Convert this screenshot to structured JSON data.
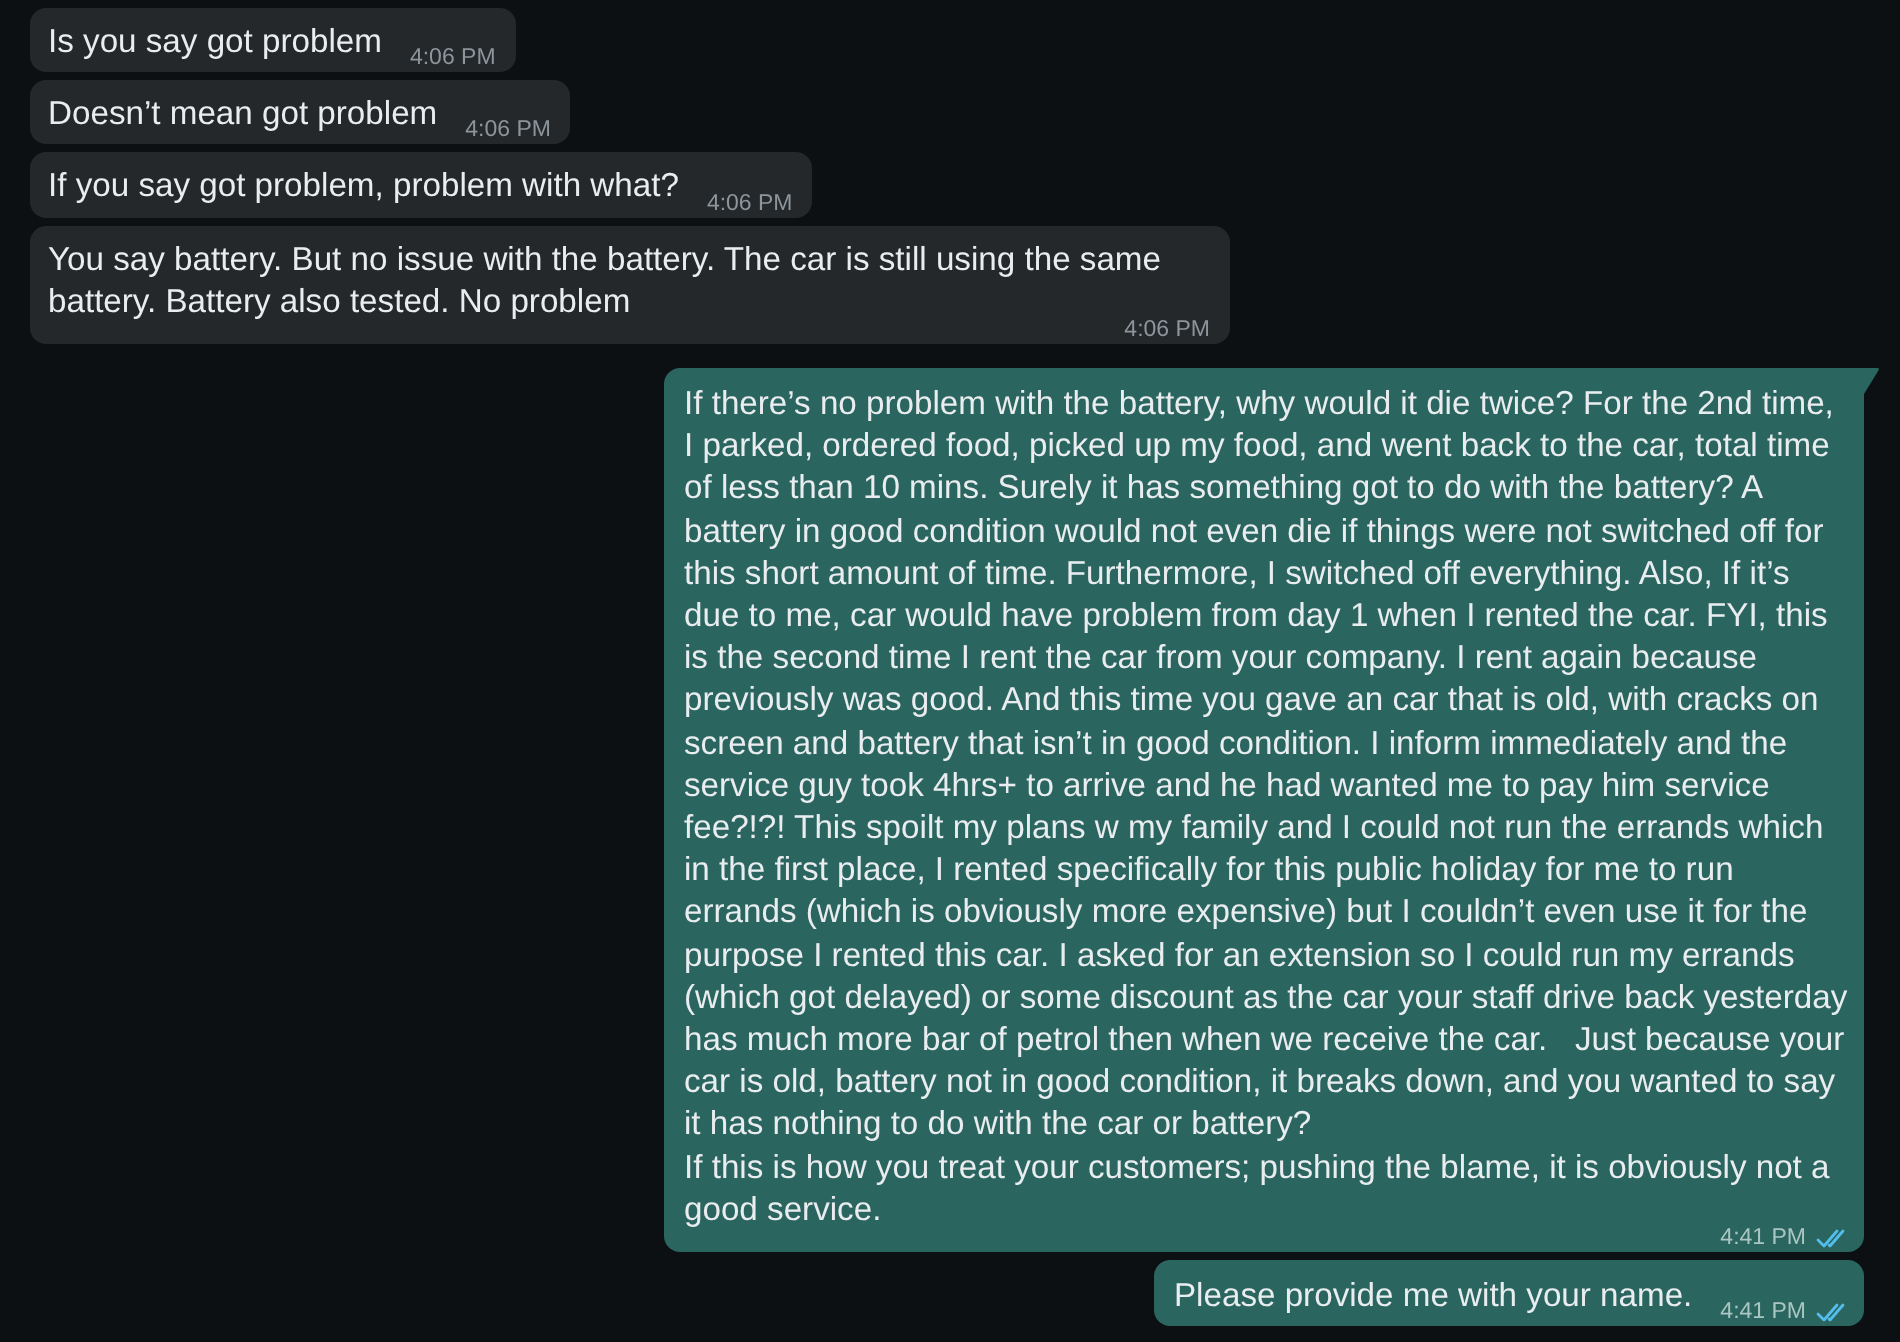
{
  "messages": [
    {
      "kind": "incoming",
      "text": "Is you say got problem",
      "time": "4:06 PM",
      "tail": false
    },
    {
      "kind": "incoming",
      "text": "Doesn’t mean got problem",
      "time": "4:06 PM",
      "tail": false
    },
    {
      "kind": "incoming",
      "text": "If you say got problem, problem with what?",
      "time": "4:06 PM",
      "tail": false
    },
    {
      "kind": "incoming",
      "text": "You say battery. But no issue with the battery. The car is still using the same battery. Battery also tested. No problem",
      "time": "4:06 PM",
      "tail": false
    },
    {
      "kind": "outgoing",
      "text": "If there’s no problem with the battery, why would it die twice? For the 2nd time, I parked, ordered food, picked up my food, and went back to the car, total time of less than 10 mins. Surely it has something got to do with the battery? A battery in good condition would not even die if things were not switched off for this short amount of time. Furthermore, I switched off everything. Also, If it’s due to me, car would have problem from day 1 when I rented the car. FYI, this is the second time I rent the car from your company. I rent again because previously was good. And this time you gave an car that is old, with cracks on screen and battery that isn’t in good condition. I inform immediately and the service guy took 4hrs+ to arrive and he had wanted me to pay him service fee?!?! This spoilt my plans w my family and I could not run the errands which in the first place, I rented specifically for this public holiday for me to run errands (which is obviously more expensive) but I couldn’t even use it for the purpose I rented this car. I asked for an extension so I could run my errands (which got delayed) or some discount as the car your staff drive back yesterday has much more bar of petrol then when we receive the car.   Just because your car is old, battery not in good condition, it breaks down, and you wanted to say it has nothing to do with the car or battery?\nIf this is how you treat your customers; pushing the blame, it is obviously not a good service.",
      "time": "4:41 PM",
      "read": true,
      "tail": true
    },
    {
      "kind": "outgoing",
      "text": "Please provide me with your name.",
      "time": "4:41 PM",
      "read": true,
      "tail": false
    }
  ]
}
